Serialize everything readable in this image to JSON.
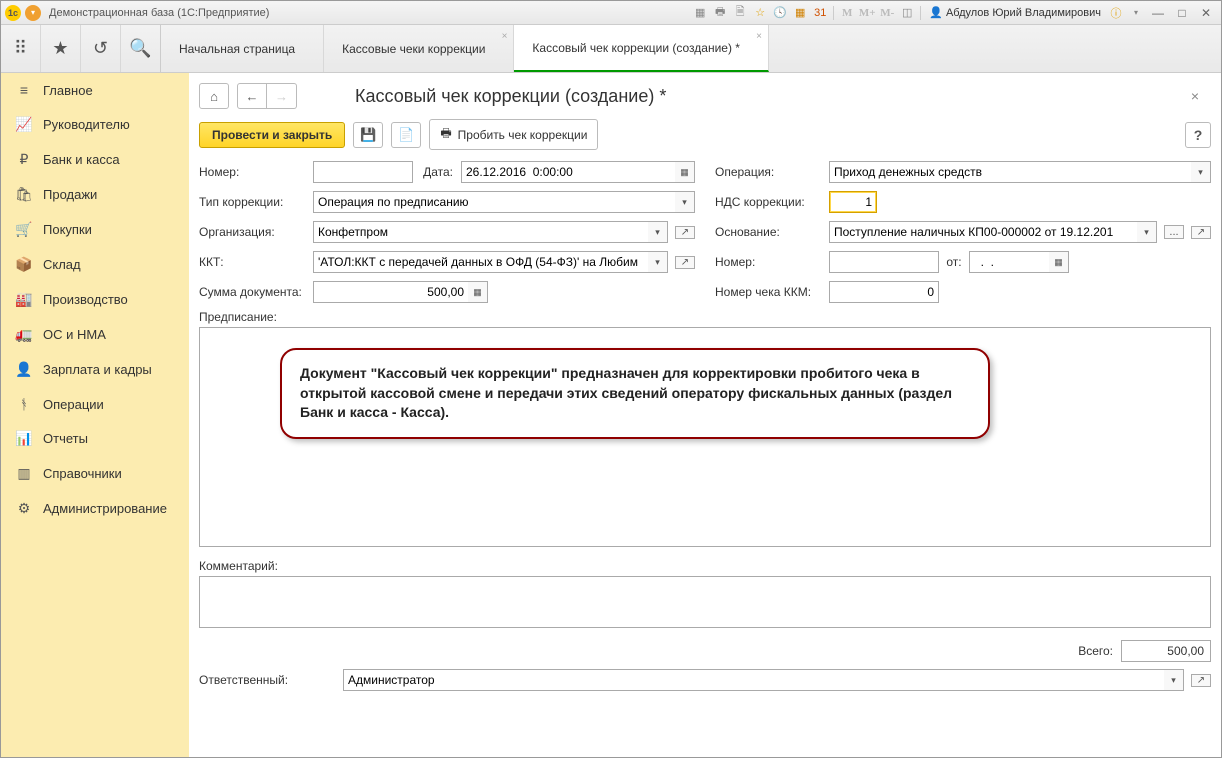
{
  "titlebar": {
    "title": "Демонстрационная база  (1С:Предприятие)",
    "user": "Абдулов Юрий Владимирович",
    "m_labels": [
      "M",
      "M+",
      "M-"
    ]
  },
  "tabs": {
    "start": "Начальная страница",
    "tab1": "Кассовые чеки коррекции",
    "tab2": "Кассовый чек коррекции (создание) *"
  },
  "sidebar": {
    "items": [
      {
        "label": "Главное",
        "icon": "≡"
      },
      {
        "label": "Руководителю",
        "icon": "📈"
      },
      {
        "label": "Банк и касса",
        "icon": "₽"
      },
      {
        "label": "Продажи",
        "icon": "🛍"
      },
      {
        "label": "Покупки",
        "icon": "🛒"
      },
      {
        "label": "Склад",
        "icon": "📦"
      },
      {
        "label": "Производство",
        "icon": "🏭"
      },
      {
        "label": "ОС и НМА",
        "icon": "🚛"
      },
      {
        "label": "Зарплата и кадры",
        "icon": "👤"
      },
      {
        "label": "Операции",
        "icon": "ᚬ"
      },
      {
        "label": "Отчеты",
        "icon": "📊"
      },
      {
        "label": "Справочники",
        "icon": "▥"
      },
      {
        "label": "Администрирование",
        "icon": "⚙"
      }
    ]
  },
  "page": {
    "title": "Кассовый чек коррекции (создание) *",
    "btn_post_close": "Провести и закрыть",
    "btn_print_check": "Пробить чек коррекции",
    "help": "?"
  },
  "form": {
    "number_label": "Номер:",
    "number_value": "",
    "date_label": "Дата:",
    "date_value": "26.12.2016  0:00:00",
    "type_label": "Тип коррекции:",
    "type_value": "Операция по предписанию",
    "org_label": "Организация:",
    "org_value": "Конфетпром",
    "kkt_label": "ККТ:",
    "kkt_value": "'АТОЛ:ККТ с передачей данных в ОФД (54-ФЗ)' на Любим",
    "sum_label": "Сумма документа:",
    "sum_value": "500,00",
    "op_label": "Операция:",
    "op_value": "Приход денежных средств",
    "vat_label": "НДС коррекции:",
    "vat_value": "1",
    "base_label": "Основание:",
    "base_value": "Поступление наличных КП00-000002 от 19.12.201",
    "base_num_label": "Номер:",
    "base_num_value": "",
    "base_from_label": "от:",
    "base_from_value": "  .  .",
    "kkm_label": "Номер чека ККМ:",
    "kkm_value": "0",
    "presc_label": "Предписание:",
    "callout": "Документ \"Кассовый чек коррекции\" предназначен для корректировки пробитого чека в открытой кассовой смене и передачи этих сведений оператору фискальных данных  (раздел Банк и касса - Касса).",
    "comment_label": "Комментарий:",
    "total_label": "Всего:",
    "total_value": "500,00",
    "resp_label": "Ответственный:",
    "resp_value": "Администратор",
    "ellipsis": "..."
  }
}
